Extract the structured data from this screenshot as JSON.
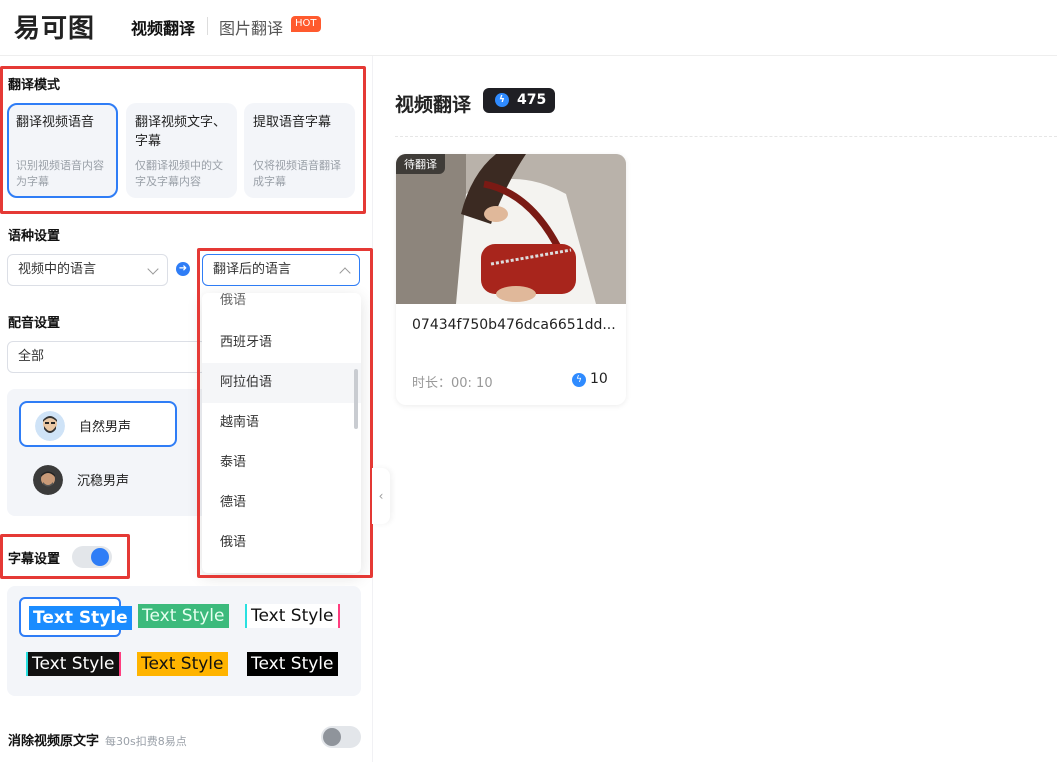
{
  "header": {
    "logo": "易可图",
    "nav_active": "视频翻译",
    "nav_other": "图片翻译",
    "hot_badge": "HOT"
  },
  "sidebar": {
    "mode_title": "翻译模式",
    "modes": [
      {
        "title": "翻译视频语音",
        "desc": "识别视频语音内容为字幕"
      },
      {
        "title": "翻译视频文字、字幕",
        "desc": "仅翻译视频中的文字及字幕内容"
      },
      {
        "title": "提取语音字幕",
        "desc": "仅将视频语音翻译成字幕"
      }
    ],
    "lang_title": "语种设置",
    "source_lang": "视频中的语言",
    "target_lang": "翻译后的语言",
    "dropdown_items": [
      "俄语",
      "西班牙语",
      "阿拉伯语",
      "越南语",
      "泰语",
      "德语",
      "俄语"
    ],
    "dub_title": "配音设置",
    "dub_filter": "全部",
    "voices": [
      "自然男声",
      "沉稳男声"
    ],
    "subtitle_title": "字幕设置",
    "subtitle_on": true,
    "text_style_label": "Text Style",
    "erase_title": "消除视频原文字",
    "erase_note": "每30s扣费8易点",
    "erase_on": false
  },
  "main": {
    "title": "视频翻译",
    "credits": "475",
    "card": {
      "status": "待翻译",
      "filename": "07434f750b476dca6651dd...",
      "duration": "时长：00: 10",
      "cost": "10"
    }
  },
  "colors": {
    "accent": "#2f7df6",
    "highlight_box": "#e53935",
    "hot": "#ff5a2e"
  }
}
